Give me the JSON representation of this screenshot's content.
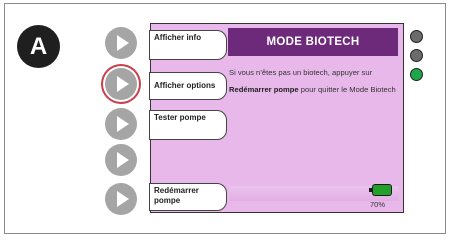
{
  "badge": "A",
  "screen": {
    "title": "MODE BIOTECH",
    "message_part1": "Si vous n’êtes pas un biotech, appuyer sur ",
    "message_bold": "Redémarrer pompe",
    "message_part2": " pour quitter le Mode Biotech",
    "battery_percent": "70%",
    "battery_level": 0.7
  },
  "menu": [
    {
      "label": "Afficher info"
    },
    {
      "label": "Afficher options"
    },
    {
      "label": "Tester pompe"
    },
    {
      "label": ""
    },
    {
      "label": "Redémarrer pompe"
    }
  ],
  "leds": [
    {
      "state": "off",
      "color": "#6b6b6b"
    },
    {
      "state": "off",
      "color": "#6b6b6b"
    },
    {
      "state": "on",
      "color": "#1ea64b"
    }
  ],
  "colors": {
    "title_bg": "#6d2a7a",
    "screen_bg": "#e8b8ea",
    "selected_ring": "#c93f4b"
  }
}
